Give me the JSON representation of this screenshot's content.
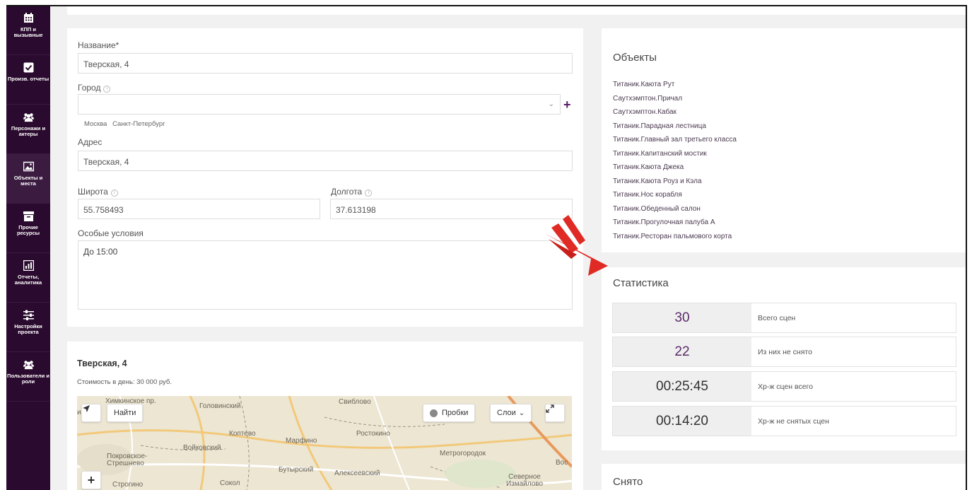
{
  "sidebar": {
    "items": [
      {
        "label": "КПП и вызывные",
        "icon": "calendar-icon"
      },
      {
        "label": "Произв. отчеты",
        "icon": "checkbox-icon"
      },
      {
        "label": "Персонажи и актеры",
        "icon": "people-icon"
      },
      {
        "label": "Объекты и места",
        "icon": "image-icon"
      },
      {
        "label": "Прочие ресурсы",
        "icon": "archive-box-icon"
      },
      {
        "label": "Отчеты, аналитика",
        "icon": "bar-chart-icon"
      },
      {
        "label": "Настройки проекта",
        "icon": "sliders-icon"
      },
      {
        "label": "Пользователи и роли",
        "icon": "users-icon"
      }
    ]
  },
  "form": {
    "name_label": "Название",
    "name_required_mark": "*",
    "name_value": "Тверская, 4",
    "city_label": "Город",
    "city_value": "",
    "city_suggestions": [
      "Москва",
      "Санкт-Петербург"
    ],
    "address_label": "Адрес",
    "address_value": "Тверская, 4",
    "lat_label": "Широта",
    "lat_value": "55.758493",
    "lon_label": "Долгота",
    "lon_value": "37.613198",
    "conditions_label": "Особые условия",
    "conditions_value": "До 15:00"
  },
  "map_card": {
    "title": "Тверская, 4",
    "cost": "Стоимость в день: 30 000 руб.",
    "find_button": "Найти",
    "traffic_button": "Пробки",
    "layers_button": "Слои",
    "zoom_in": "+",
    "places": [
      "Головинский",
      "Свиблово",
      "Коптево",
      "Ростокино",
      "Марфино",
      "Войковский",
      "Метрогородок",
      "Покровское-Стрешнево",
      "Бутырский",
      "Алексеевский",
      "Северное Измайлово",
      "Строгино",
      "Сокол",
      "Химкинское пр.",
      "ино",
      "Вос"
    ]
  },
  "objects": {
    "title": "Объекты",
    "items": [
      "Титаник.Каюта Рут",
      "Саутхэмптон.Причал",
      "Саутхэмптон.Кабак",
      "Титаник.Парадная лестница",
      "Титаник.Главный зал третьего класса",
      "Титаник.Капитанский мостик",
      "Титаник.Каюта Джека",
      "Титаник.Каюта Роуз и Кэла",
      "Титаник.Нос корабля",
      "Титаник.Обеденный салон",
      "Титаник.Прогулочная палуба А",
      "Титаник.Ресторан пальмового корта"
    ]
  },
  "stats": {
    "title": "Статистика",
    "rows": [
      {
        "value": "30",
        "label": "Всего сцен"
      },
      {
        "value": "22",
        "label": "Из них не снято"
      },
      {
        "value": "00:25:45",
        "label": "Хр-ж сцен всего"
      },
      {
        "value": "00:14:20",
        "label": "Хр-ж не снятых сцен"
      }
    ]
  },
  "taken": {
    "title": "Снято"
  },
  "colors": {
    "sidebar": "#2a0a2e",
    "accent": "#5c2a6a",
    "arrow": "#e02a24"
  }
}
